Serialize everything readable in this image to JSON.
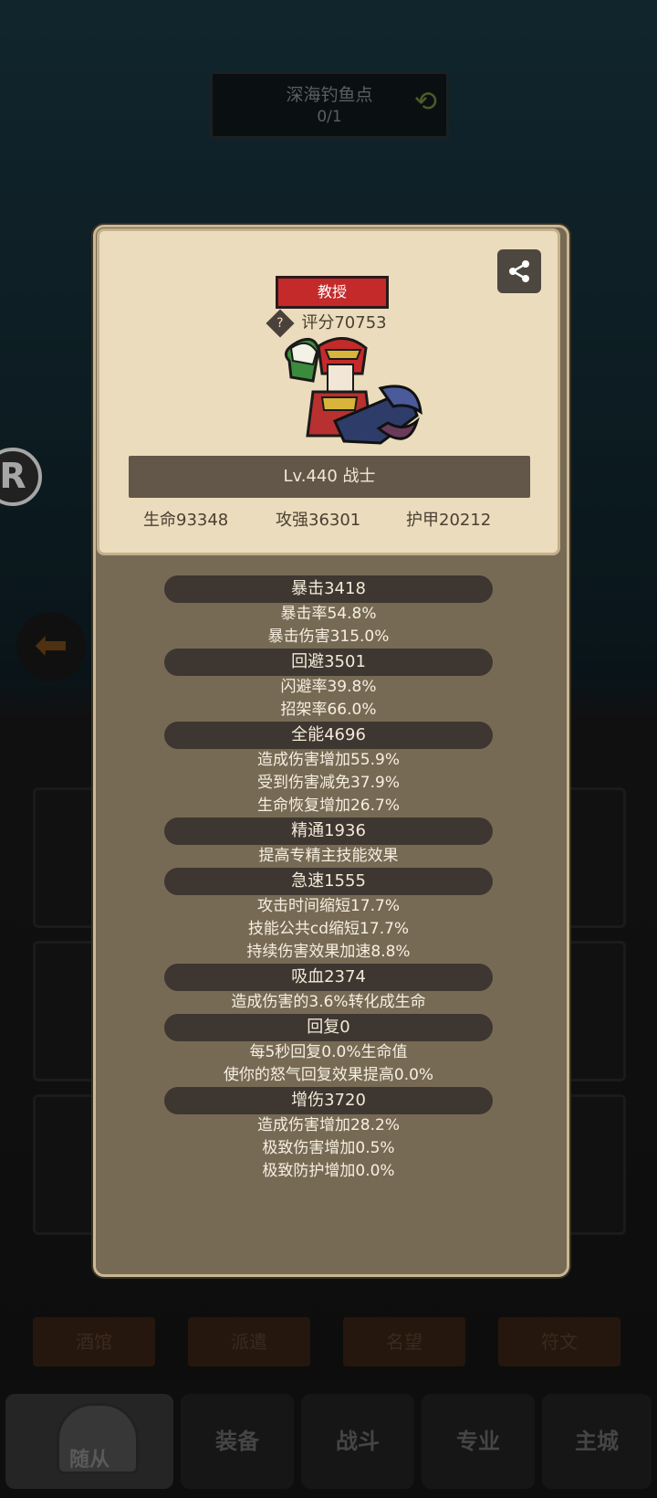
{
  "location": {
    "name": "深海钓鱼点",
    "progress": "0/1"
  },
  "bg_sub_tabs": [
    "酒馆",
    "派遣",
    "名望",
    "符文"
  ],
  "bottom_nav": [
    {
      "label": "随从",
      "active": true
    },
    {
      "label": "装备",
      "active": false
    },
    {
      "label": "战斗",
      "active": false
    },
    {
      "label": "专业",
      "active": false
    },
    {
      "label": "主城",
      "active": false
    }
  ],
  "hero": {
    "rank": "教授",
    "score": "评分70753",
    "level_class": "Lv.440 战士",
    "basic_stats": [
      {
        "label": "生命93348"
      },
      {
        "label": "攻强36301"
      },
      {
        "label": "护甲20212"
      }
    ]
  },
  "stat_groups": [
    {
      "title": "暴击3418",
      "lines": [
        "暴击率54.8%",
        "暴击伤害315.0%"
      ]
    },
    {
      "title": "回避3501",
      "lines": [
        "闪避率39.8%",
        "招架率66.0%"
      ]
    },
    {
      "title": "全能4696",
      "lines": [
        "造成伤害增加55.9%",
        "受到伤害减免37.9%",
        "生命恢复增加26.7%"
      ]
    },
    {
      "title": "精通1936",
      "lines": [
        "提高专精主技能效果"
      ]
    },
    {
      "title": "急速1555",
      "lines": [
        "攻击时间缩短17.7%",
        "技能公共cd缩短17.7%",
        "持续伤害效果加速8.8%"
      ]
    },
    {
      "title": "吸血2374",
      "lines": [
        "造成伤害的3.6%转化成生命"
      ]
    },
    {
      "title": "回复0",
      "lines": [
        "每5秒回复0.0%生命值",
        "使你的怒气回复效果提高0.0%"
      ]
    },
    {
      "title": "增伤3720",
      "lines": [
        "造成伤害增加28.2%",
        "极致伤害增加0.5%",
        "极致防护增加0.0%"
      ]
    }
  ],
  "colors": {
    "rank_badge": "#c42a2a",
    "panel": "#776a55",
    "card": "#eadcbc"
  },
  "icons": [
    "refresh-icon",
    "share-icon",
    "help-icon",
    "back-arrow-icon"
  ]
}
